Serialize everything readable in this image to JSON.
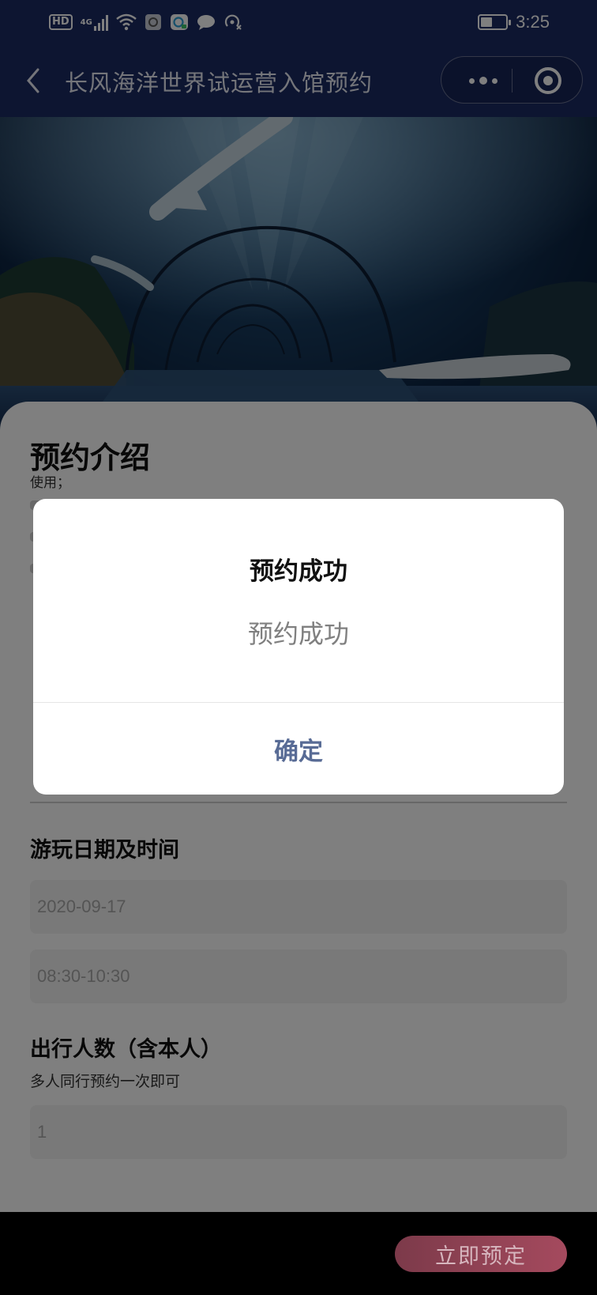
{
  "status_bar": {
    "network": "HD",
    "signal_type": "4G",
    "time": "3:25",
    "battery_percent": 45
  },
  "navbar": {
    "title": "长风海洋世界试运营入馆预约"
  },
  "intro": {
    "title": "预约介绍",
    "visible_text": "使用；"
  },
  "visit": {
    "title": "游玩日期及时间",
    "date_value": "2020-09-17",
    "time_value": "08:30-10:30"
  },
  "party": {
    "title": "出行人数（含本人）",
    "hint": "多人同行预约一次即可",
    "count_value": "1"
  },
  "bottom": {
    "book_button": "立即预定"
  },
  "dialog": {
    "title": "预约成功",
    "message": "预约成功",
    "confirm_label": "确定"
  },
  "colors": {
    "header_bg": "#1b2a63",
    "confirm_text": "#586b95",
    "book_button": "#a54a5e"
  }
}
